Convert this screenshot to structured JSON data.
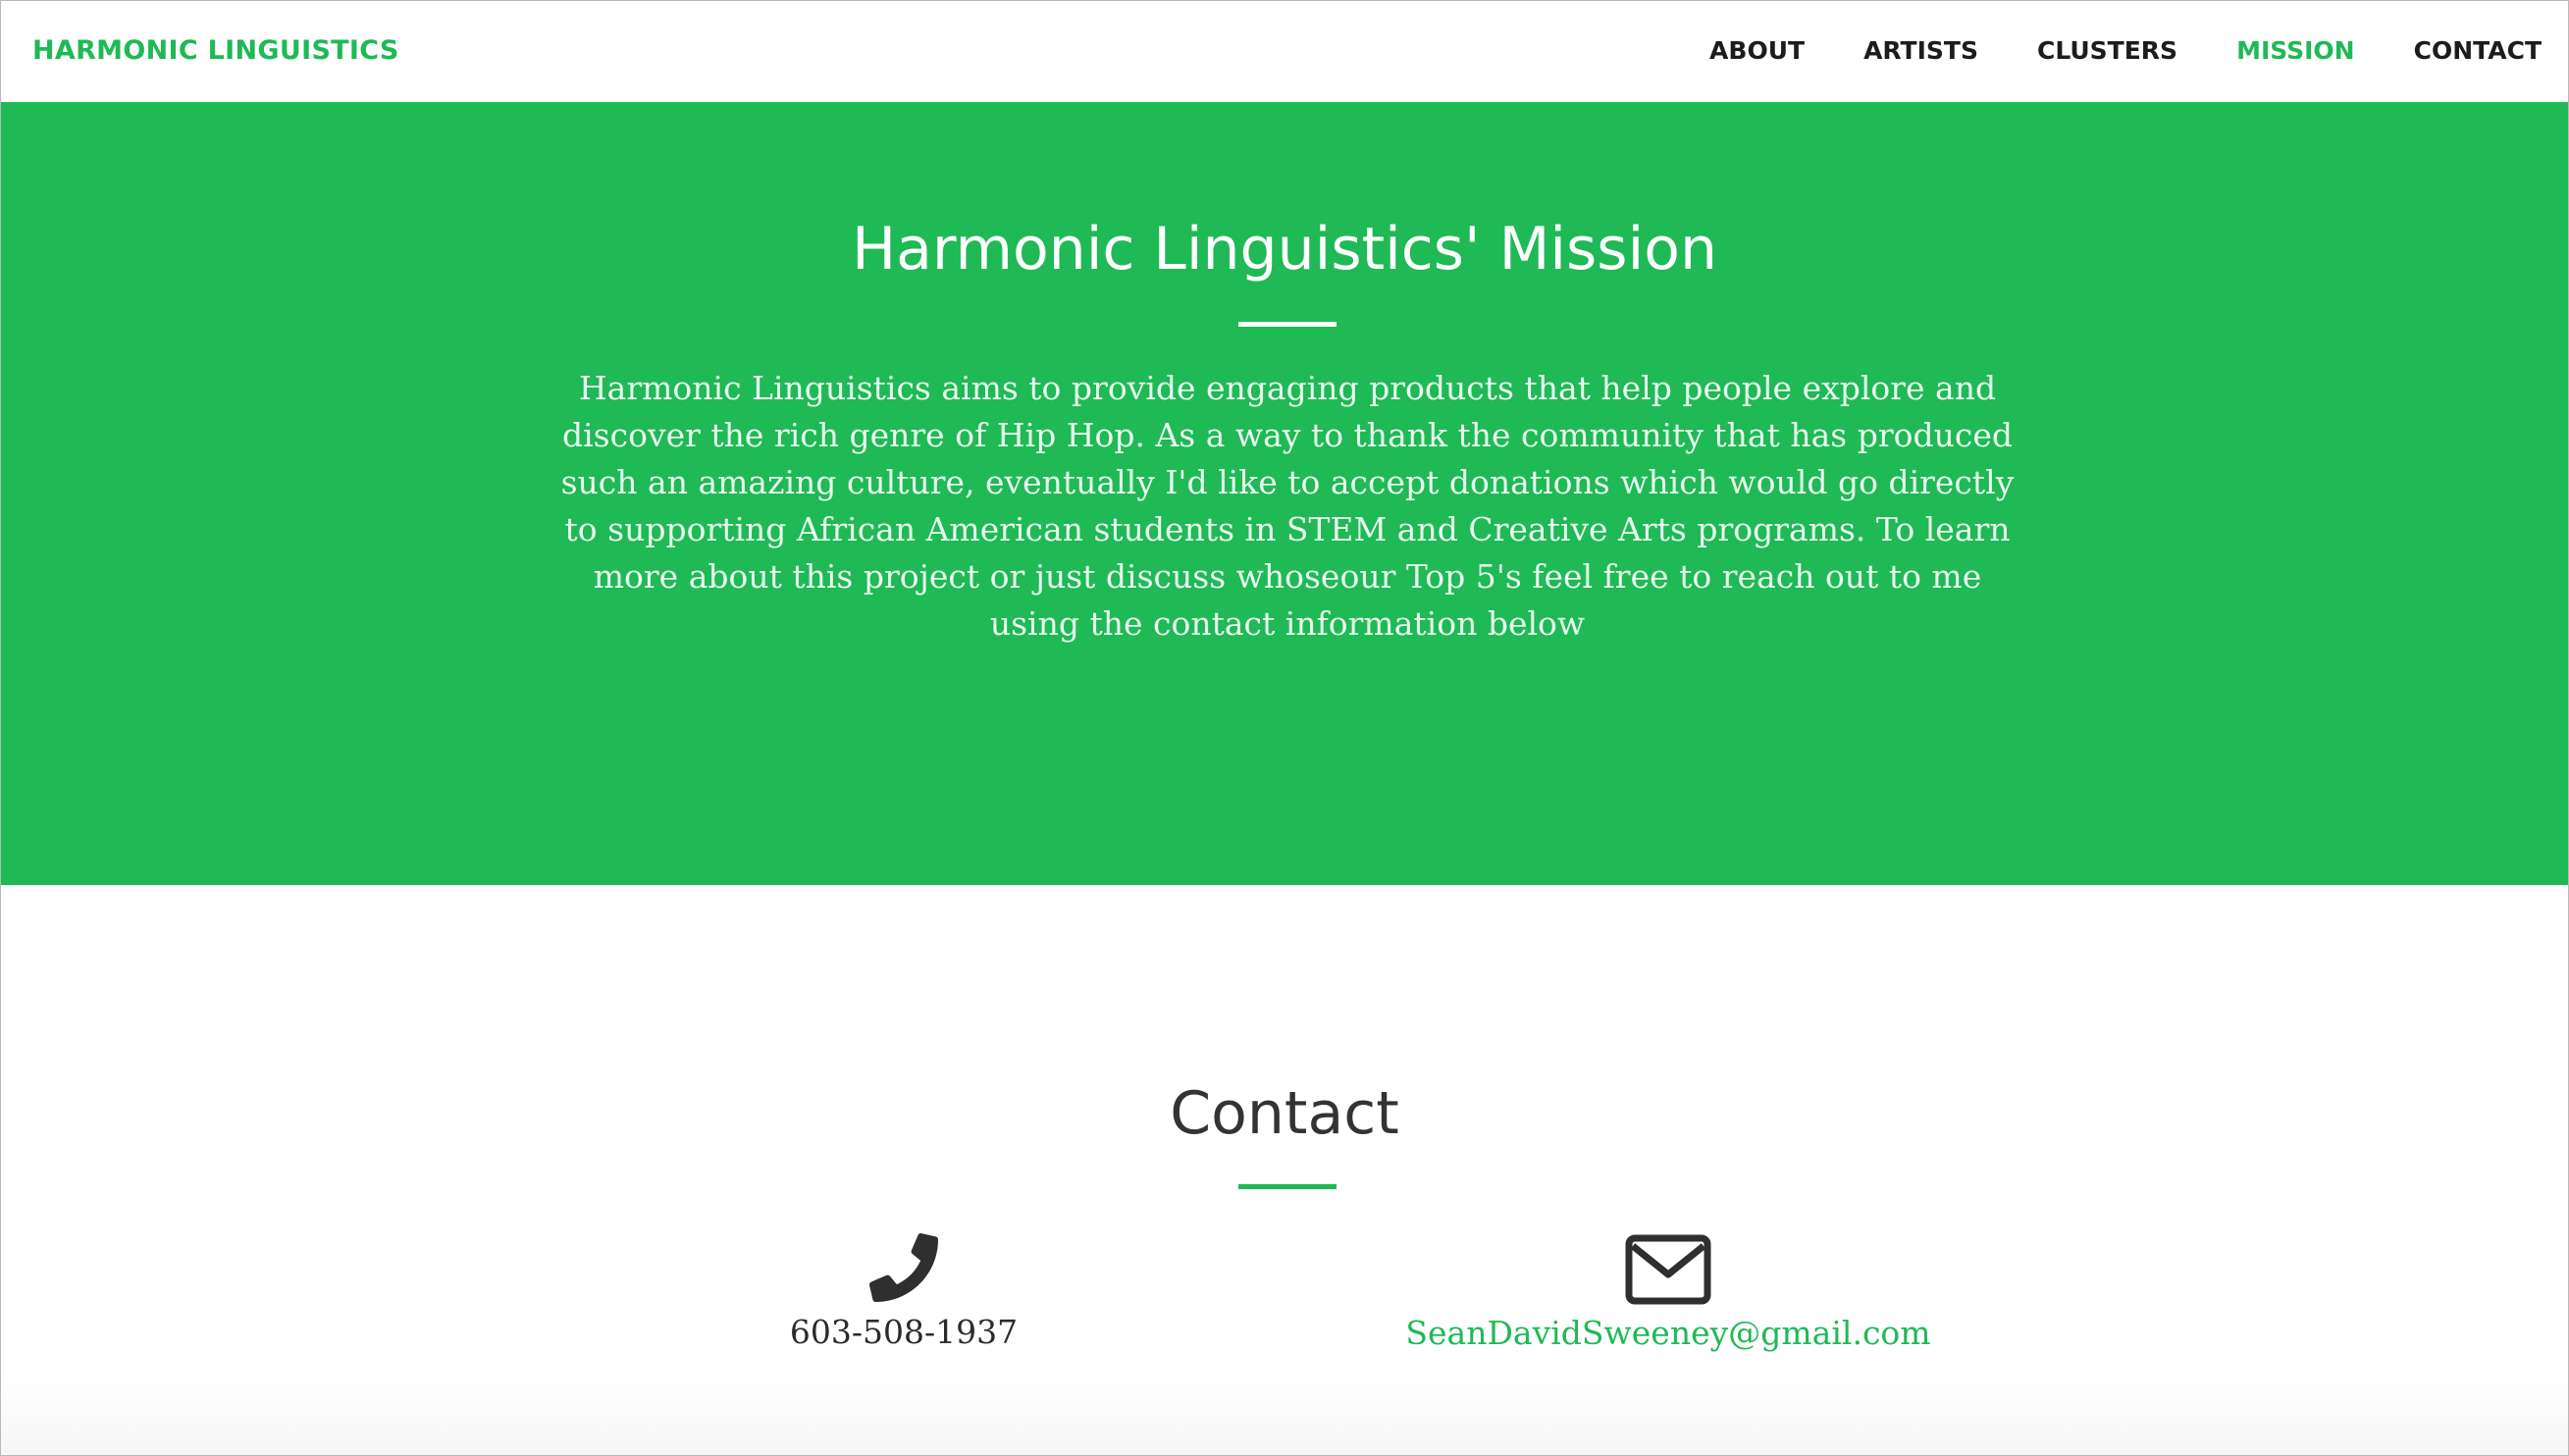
{
  "brand": {
    "name": "HARMONIC LINGUISTICS",
    "accent_color": "#1fb955"
  },
  "nav": {
    "items": [
      {
        "label": "ABOUT",
        "active": false
      },
      {
        "label": "ARTISTS",
        "active": false
      },
      {
        "label": "CLUSTERS",
        "active": false
      },
      {
        "label": "MISSION",
        "active": true
      },
      {
        "label": "CONTACT",
        "active": false
      }
    ]
  },
  "mission": {
    "title": "Harmonic Linguistics' Mission",
    "body": "Harmonic Linguistics aims to provide engaging products that help people explore and discover the rich genre of Hip Hop. As a way to thank the community that has produced such an amazing culture, eventually I'd like to accept donations which would go directly to supporting African American students in STEM and Creative Arts programs. To learn more about this project or just discuss whoseour Top 5's feel free to reach out to me using the contact information below",
    "background_color": "#1fb955"
  },
  "contact": {
    "title": "Contact",
    "phone": {
      "icon": "phone-icon",
      "text": "603-508-1937"
    },
    "email": {
      "icon": "envelope-icon",
      "text": "SeanDavidSweeney@gmail.com"
    }
  }
}
